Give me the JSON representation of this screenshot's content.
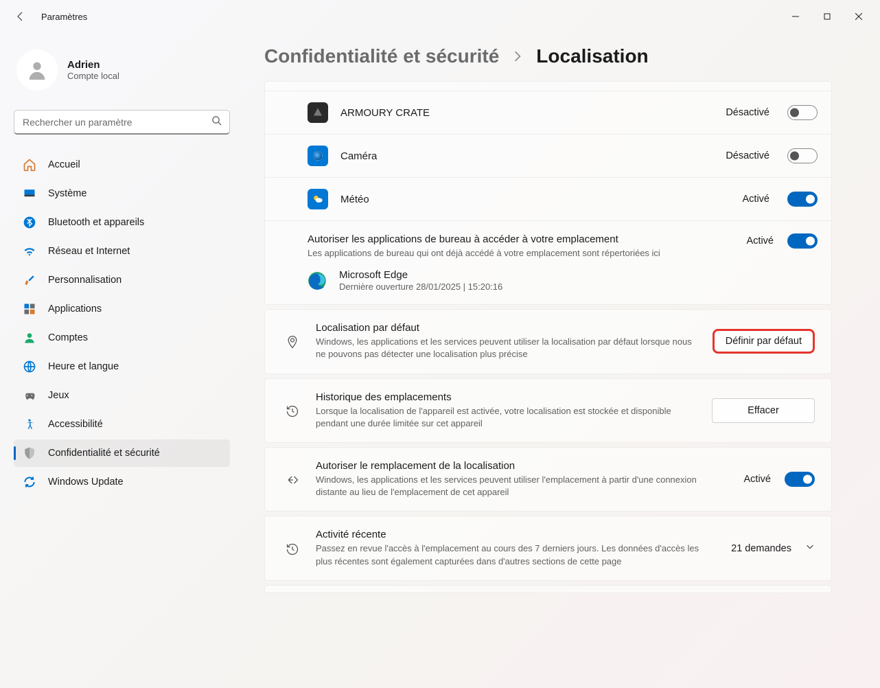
{
  "app": {
    "title": "Paramètres"
  },
  "user": {
    "name": "Adrien",
    "sub": "Compte local"
  },
  "search": {
    "placeholder": "Rechercher un paramètre"
  },
  "nav": [
    {
      "label": "Accueil"
    },
    {
      "label": "Système"
    },
    {
      "label": "Bluetooth et appareils"
    },
    {
      "label": "Réseau et Internet"
    },
    {
      "label": "Personnalisation"
    },
    {
      "label": "Applications"
    },
    {
      "label": "Comptes"
    },
    {
      "label": "Heure et langue"
    },
    {
      "label": "Jeux"
    },
    {
      "label": "Accessibilité"
    },
    {
      "label": "Confidentialité et sécurité"
    },
    {
      "label": "Windows Update"
    }
  ],
  "breadcrumb": {
    "parent": "Confidentialité et sécurité",
    "current": "Localisation"
  },
  "status": {
    "on": "Activé",
    "off": "Désactivé"
  },
  "apps": [
    {
      "name": "ARMOURY CRATE",
      "state": "off"
    },
    {
      "name": "Caméra",
      "state": "off"
    },
    {
      "name": "Météo",
      "state": "on"
    }
  ],
  "desktop": {
    "title": "Autoriser les applications de bureau à accéder à votre emplacement",
    "desc": "Les applications de bureau qui ont déjà accédé à votre emplacement sont répertoriées ici",
    "state": "on",
    "edge": {
      "name": "Microsoft Edge",
      "last": "Dernière ouverture 28/01/2025  |  15:20:16"
    }
  },
  "default_loc": {
    "title": "Localisation par défaut",
    "desc": "Windows, les applications et les services peuvent utiliser la localisation par défaut lorsque nous ne pouvons pas détecter une localisation plus précise",
    "button": "Définir par défaut"
  },
  "history": {
    "title": "Historique des emplacements",
    "desc": "Lorsque la localisation de l'appareil est activée, votre localisation est stockée et disponible pendant une durée limitée sur cet appareil",
    "button": "Effacer"
  },
  "override": {
    "title": "Autoriser le remplacement de la localisation",
    "desc": "Windows, les applications et les services peuvent utiliser l'emplacement à partir d'une connexion distante au lieu de l'emplacement de cet appareil",
    "state": "on"
  },
  "recent": {
    "title": "Activité récente",
    "desc": "Passez en revue l'accès à l'emplacement au cours des 7 derniers jours. Les données d'accès les plus récentes sont également capturées dans d'autres sections de cette page",
    "count": "21 demandes"
  }
}
